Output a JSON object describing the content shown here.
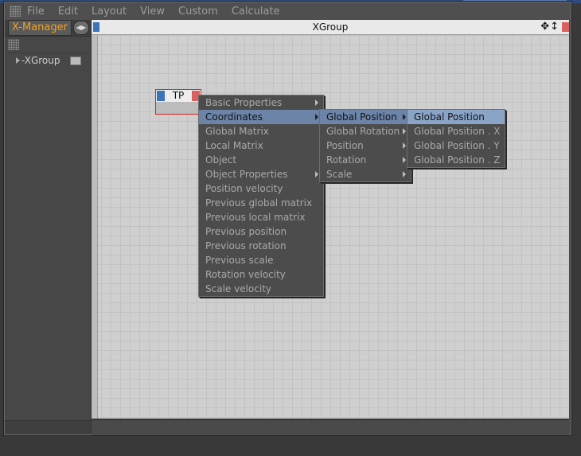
{
  "menubar": {
    "items": [
      "File",
      "Edit",
      "Layout",
      "View",
      "Custom",
      "Calculate"
    ]
  },
  "left_panel": {
    "tab_label": "X-Manager",
    "tree": [
      {
        "label": "-XGroup"
      }
    ]
  },
  "canvas": {
    "title": "XGroup"
  },
  "node": {
    "title": "TP"
  },
  "context_menu": {
    "level1": [
      {
        "label": "Basic Properties",
        "submenu": true
      },
      {
        "label": "Coordinates",
        "submenu": true
      },
      {
        "label": "Global Matrix",
        "submenu": false
      },
      {
        "label": "Local Matrix",
        "submenu": false
      },
      {
        "label": "Object",
        "submenu": false
      },
      {
        "label": "Object Properties",
        "submenu": true
      },
      {
        "label": "Position velocity",
        "submenu": false
      },
      {
        "label": "Previous global matrix",
        "submenu": false
      },
      {
        "label": "Previous local matrix",
        "submenu": false
      },
      {
        "label": "Previous position",
        "submenu": false
      },
      {
        "label": "Previous rotation",
        "submenu": false
      },
      {
        "label": "Previous scale",
        "submenu": false
      },
      {
        "label": "Rotation velocity",
        "submenu": false
      },
      {
        "label": "Scale velocity",
        "submenu": false
      }
    ],
    "level2": [
      {
        "label": "Global Position",
        "submenu": true
      },
      {
        "label": "Global Rotation",
        "submenu": true
      },
      {
        "label": "Position",
        "submenu": true
      },
      {
        "label": "Rotation",
        "submenu": true
      },
      {
        "label": "Scale",
        "submenu": true
      }
    ],
    "level3": [
      {
        "label": "Global Position"
      },
      {
        "label": "Global Position . X"
      },
      {
        "label": "Global Position . Y"
      },
      {
        "label": "Global Position . Z"
      }
    ]
  },
  "colors": {
    "tab_text": "#f0a020",
    "highlight": "#8aa4c8",
    "port_in": "#3d74b8",
    "port_out": "#d86060",
    "node_border": "#d02828"
  }
}
